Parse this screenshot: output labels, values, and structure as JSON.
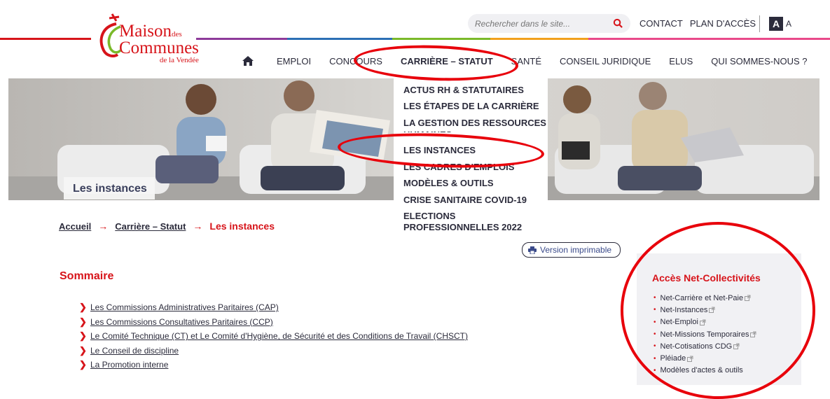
{
  "colors": {
    "brand_red": "#d7141a",
    "annotation_red": "#e8000b",
    "text_dark": "#2b2b3b",
    "top_line": [
      "#d7141a",
      "#8e3b9a",
      "#2b6fb5",
      "#7ab929",
      "#f2a11d",
      "#e94a8a"
    ]
  },
  "logo": {
    "line1": "Maison",
    "line1_small": "des",
    "line2": "Communes",
    "line3": "de la Vendée"
  },
  "search": {
    "placeholder": "Rechercher dans le site..."
  },
  "top_links": {
    "contact": "CONTACT",
    "plan": "PLAN D'ACCÈS"
  },
  "font_toggle": {
    "big": "A",
    "small": "A"
  },
  "nav": {
    "home_icon": "home-icon",
    "items": [
      "EMPLOI",
      "CONCOURS",
      "CARRIÈRE – STATUT",
      "SANTÉ",
      "CONSEIL JURIDIQUE",
      "ELUS",
      "QUI SOMMES-NOUS ?"
    ],
    "active": "CARRIÈRE – STATUT"
  },
  "dropdown": {
    "items": [
      "ACTUS RH & STATUTAIRES",
      "LES ÉTAPES DE LA CARRIÈRE",
      "LA GESTION DES RESSOURCES HUMAINES",
      "LES INSTANCES",
      "LES CADRES D'EMPLOIS",
      "MODÈLES & OUTILS",
      "CRISE SANITAIRE COVID-19",
      "ELECTIONS PROFESSIONNELLES 2022"
    ]
  },
  "hero": {
    "title": "Les instances"
  },
  "breadcrumb": {
    "home": "Accueil",
    "parent": "Carrière – Statut",
    "current": "Les instances",
    "separator": "→"
  },
  "print_button": {
    "label": "Version imprimable",
    "icon": "printer-icon"
  },
  "sommaire": {
    "title": "Sommaire",
    "items": [
      "Les Commissions Administratives Paritaires (CAP)",
      "Les Commissions Consultatives Paritaires (CCP)",
      "Le Comité Technique (CT) et Le Comité d'Hygiène, de Sécurité et des Conditions de Travail (CHSCT)",
      "Le Conseil de discipline",
      "La Promotion interne"
    ]
  },
  "net_box": {
    "title": "Accès Net-Collectivités",
    "items": [
      "Net-Carrière et Net-Paie",
      "Net-Instances",
      "Net-Emploi",
      "Net-Missions Temporaires",
      "Net-Cotisations CDG",
      "Pléiade",
      "Modèles d'actes & outils"
    ],
    "external_icon_after": [
      true,
      true,
      true,
      true,
      true,
      true,
      false
    ]
  }
}
